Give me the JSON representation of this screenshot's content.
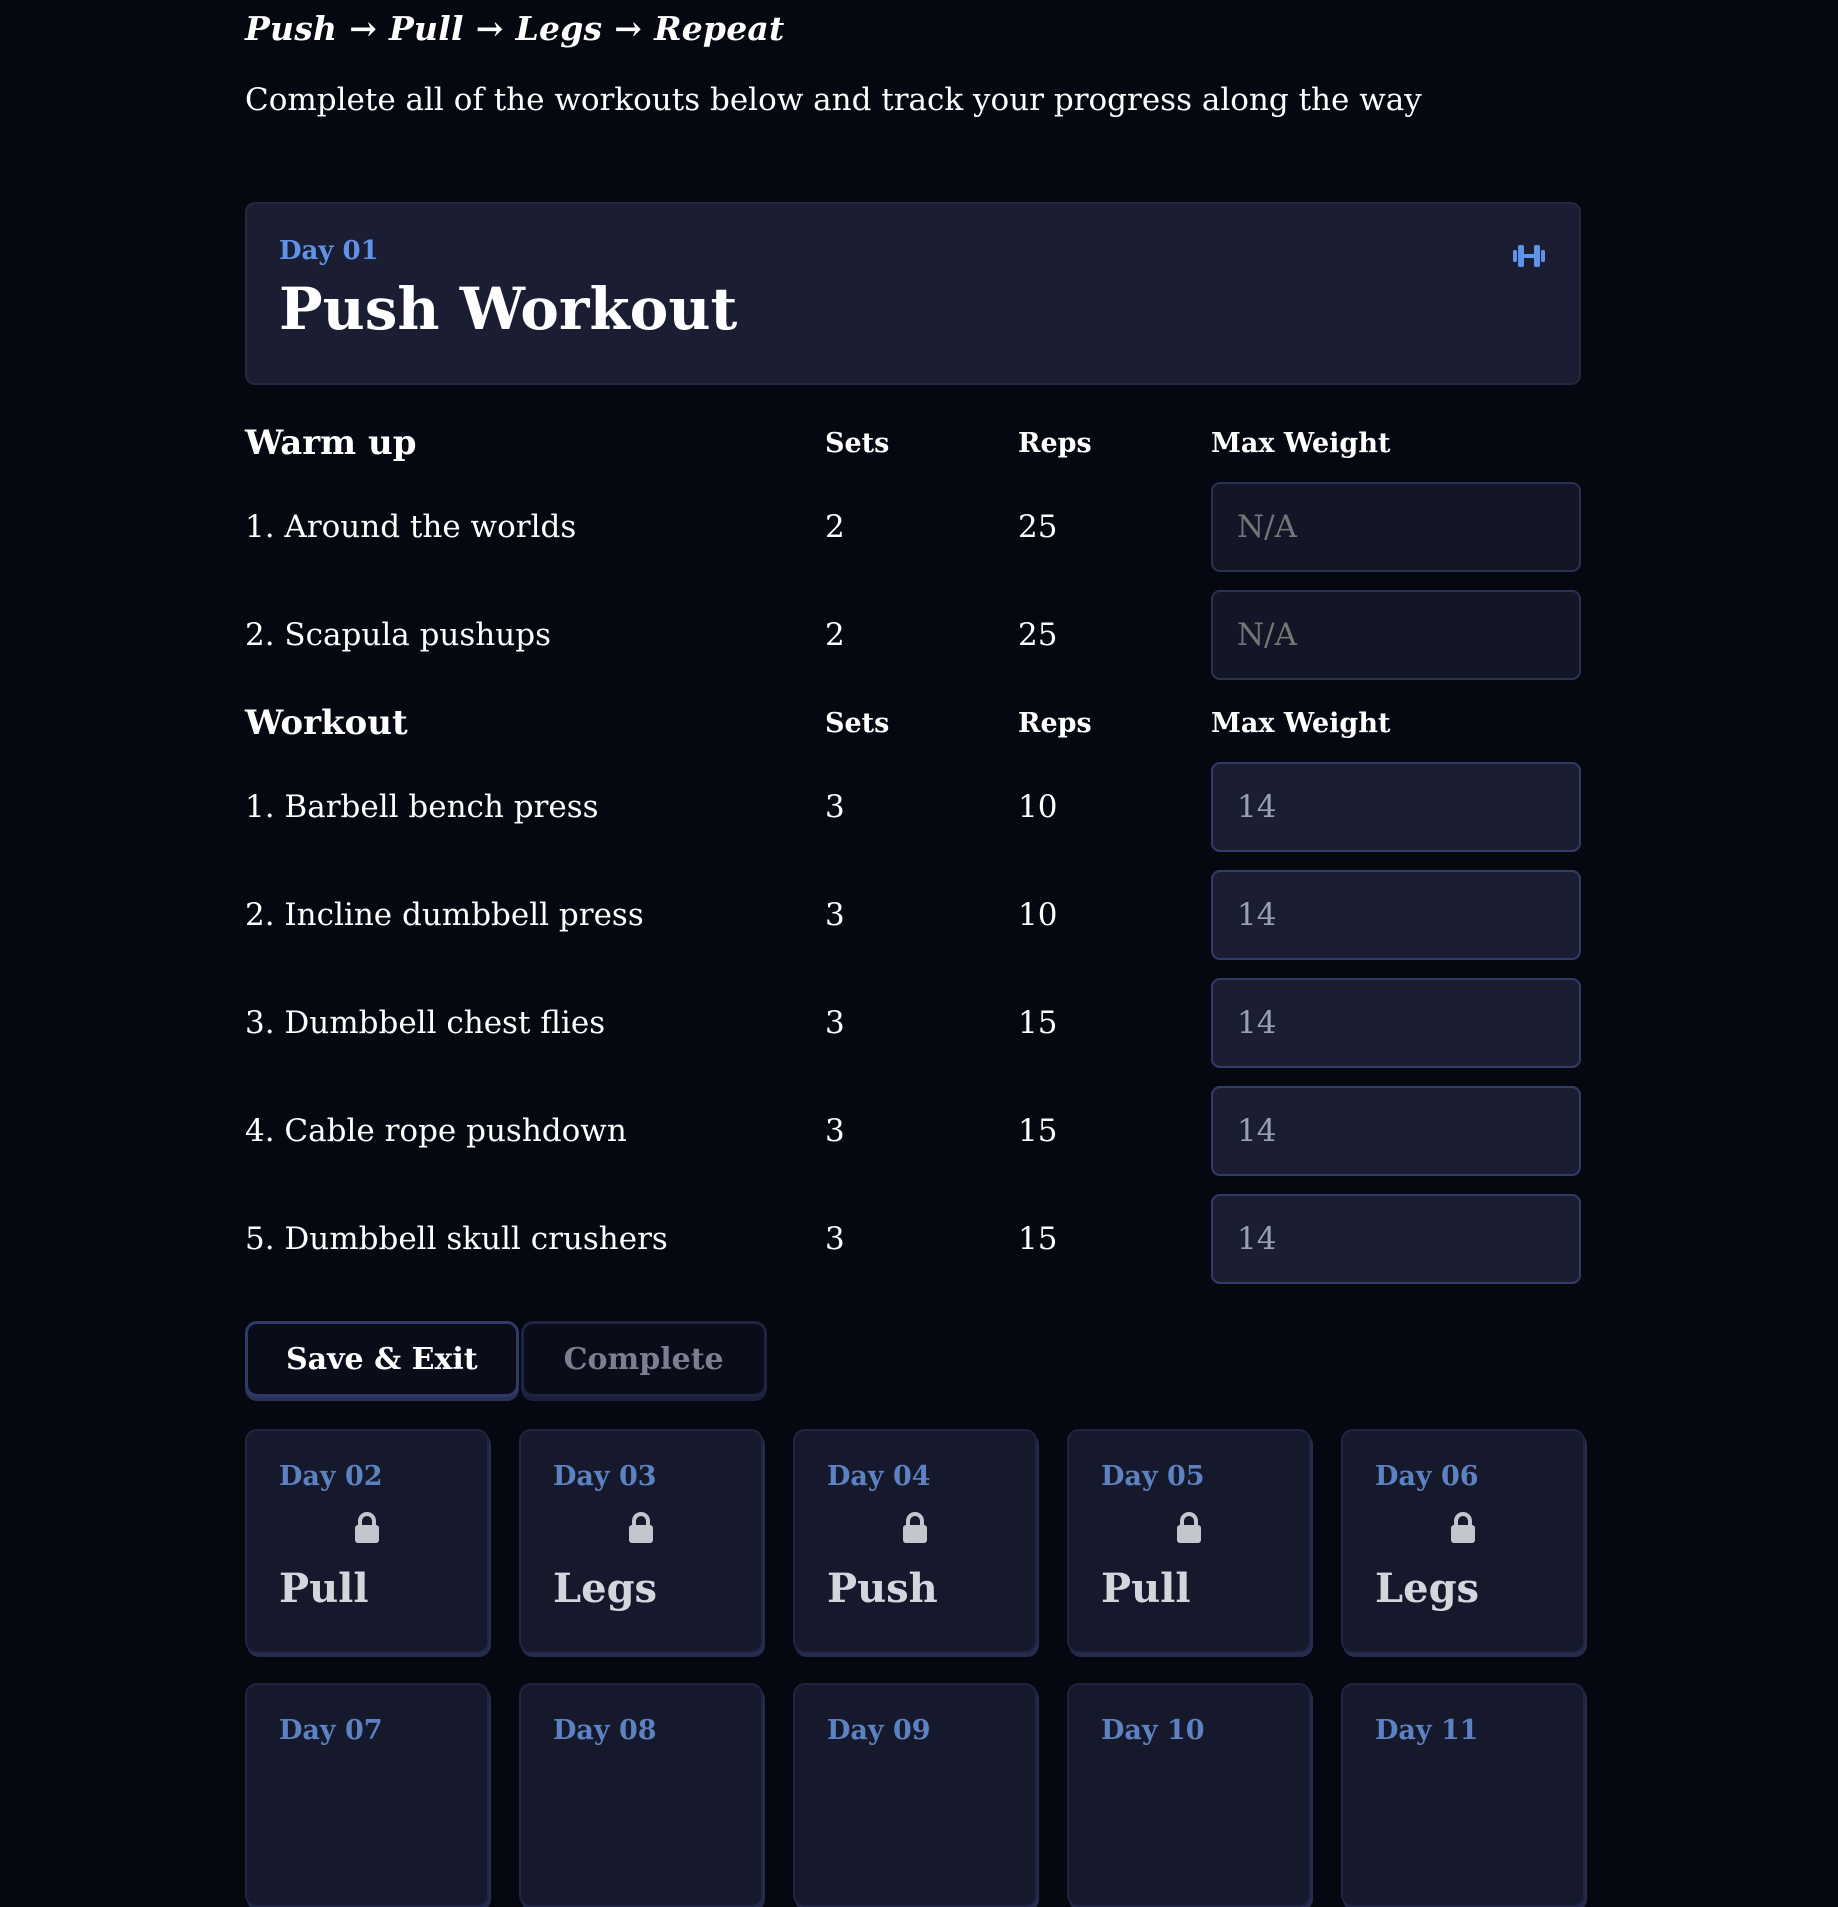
{
  "header": {
    "sequence": [
      "Push",
      "Pull",
      "Legs",
      "Repeat"
    ],
    "arrow": "→",
    "subtitle": "Complete all of the workouts below and track your progress along the way"
  },
  "current_day": {
    "day_label": "Day 01",
    "title": "Push Workout",
    "icon": "dumbbell-icon"
  },
  "columns": {
    "sets": "Sets",
    "reps": "Reps",
    "max_weight": "Max Weight"
  },
  "warmup": {
    "title": "Warm up",
    "exercises": [
      {
        "name": "1. Around the worlds",
        "sets": "2",
        "reps": "25",
        "weight": "",
        "placeholder": "N/A"
      },
      {
        "name": "2. Scapula pushups",
        "sets": "2",
        "reps": "25",
        "weight": "",
        "placeholder": "N/A"
      }
    ]
  },
  "workout": {
    "title": "Workout",
    "exercises": [
      {
        "name": "1. Barbell bench press",
        "sets": "3",
        "reps": "10",
        "weight": "14"
      },
      {
        "name": "2. Incline dumbbell press",
        "sets": "3",
        "reps": "10",
        "weight": "14"
      },
      {
        "name": "3. Dumbbell chest flies",
        "sets": "3",
        "reps": "15",
        "weight": "14"
      },
      {
        "name": "4. Cable rope pushdown",
        "sets": "3",
        "reps": "15",
        "weight": "14"
      },
      {
        "name": "5. Dumbbell skull crushers",
        "sets": "3",
        "reps": "15",
        "weight": "14"
      }
    ]
  },
  "buttons": {
    "save": "Save & Exit",
    "complete": "Complete"
  },
  "upcoming_days": [
    {
      "day": "Day 02",
      "name": "Pull",
      "icon": "lock-icon"
    },
    {
      "day": "Day 03",
      "name": "Legs",
      "icon": "lock-icon"
    },
    {
      "day": "Day 04",
      "name": "Push",
      "icon": "lock-icon"
    },
    {
      "day": "Day 05",
      "name": "Pull",
      "icon": "lock-icon"
    },
    {
      "day": "Day 06",
      "name": "Legs",
      "icon": "lock-icon"
    },
    {
      "day": "Day 07",
      "name": "",
      "icon": "lock-icon"
    },
    {
      "day": "Day 08",
      "name": "",
      "icon": "lock-icon"
    },
    {
      "day": "Day 09",
      "name": "",
      "icon": "lock-icon"
    },
    {
      "day": "Day 10",
      "name": "",
      "icon": "lock-icon"
    },
    {
      "day": "Day 11",
      "name": "",
      "icon": "lock-icon"
    }
  ],
  "colors": {
    "background": "#050811",
    "card": "#1b1e33",
    "accent": "#5f93e8"
  }
}
